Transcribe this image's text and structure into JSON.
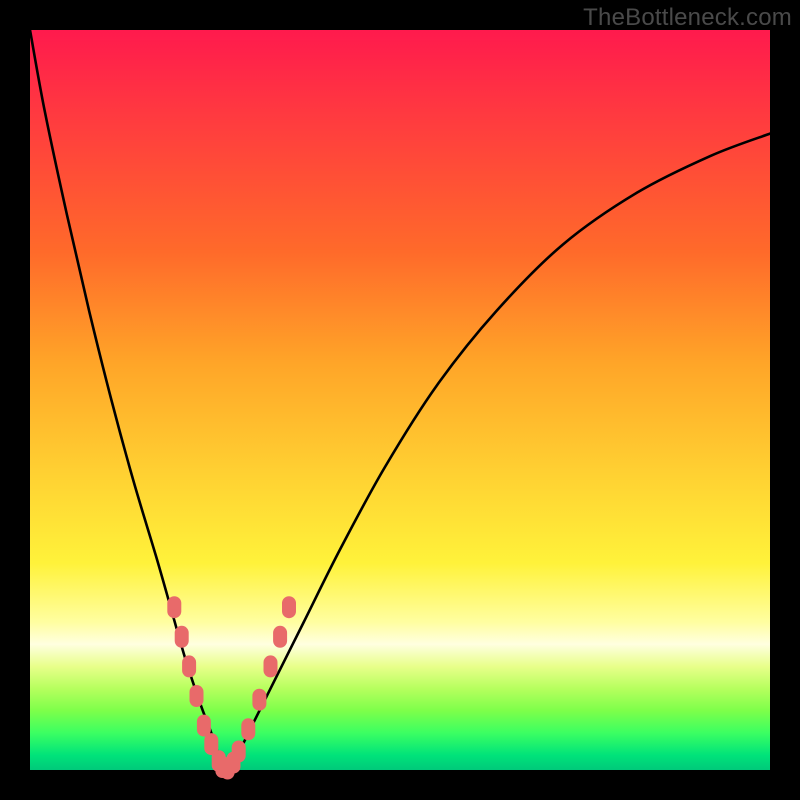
{
  "watermark": "TheBottleneck.com",
  "colors": {
    "frame": "#000000",
    "curve": "#000000",
    "markers": "#e86a6a",
    "gradient_top": "#ff1a4d",
    "gradient_bottom": "#00c97a"
  },
  "chart_data": {
    "type": "line",
    "title": "",
    "xlabel": "",
    "ylabel": "",
    "xlim": [
      0,
      100
    ],
    "ylim": [
      0,
      100
    ],
    "series": [
      {
        "name": "bottleneck-curve",
        "x": [
          0,
          2,
          5,
          8,
          11,
          14,
          17,
          19,
          21,
          23,
          24.5,
          25.5,
          26.5,
          28,
          30,
          33,
          37,
          42,
          48,
          55,
          63,
          72,
          82,
          92,
          100
        ],
        "y": [
          100,
          89,
          75,
          62,
          50,
          39,
          29,
          22,
          15,
          9,
          5,
          2,
          0,
          2,
          6,
          12,
          20,
          30,
          41,
          52,
          62,
          71,
          78,
          83,
          86
        ]
      }
    ],
    "markers": {
      "name": "highlight-dots",
      "points": [
        {
          "x": 19.5,
          "y": 22
        },
        {
          "x": 20.5,
          "y": 18
        },
        {
          "x": 21.5,
          "y": 14
        },
        {
          "x": 22.5,
          "y": 10
        },
        {
          "x": 23.5,
          "y": 6
        },
        {
          "x": 24.5,
          "y": 3.5
        },
        {
          "x": 25.5,
          "y": 1.2
        },
        {
          "x": 26.0,
          "y": 0.4
        },
        {
          "x": 26.7,
          "y": 0.2
        },
        {
          "x": 27.5,
          "y": 1.0
        },
        {
          "x": 28.2,
          "y": 2.5
        },
        {
          "x": 29.5,
          "y": 5.5
        },
        {
          "x": 31.0,
          "y": 9.5
        },
        {
          "x": 32.5,
          "y": 14
        },
        {
          "x": 33.8,
          "y": 18
        },
        {
          "x": 35.0,
          "y": 22
        }
      ]
    }
  }
}
